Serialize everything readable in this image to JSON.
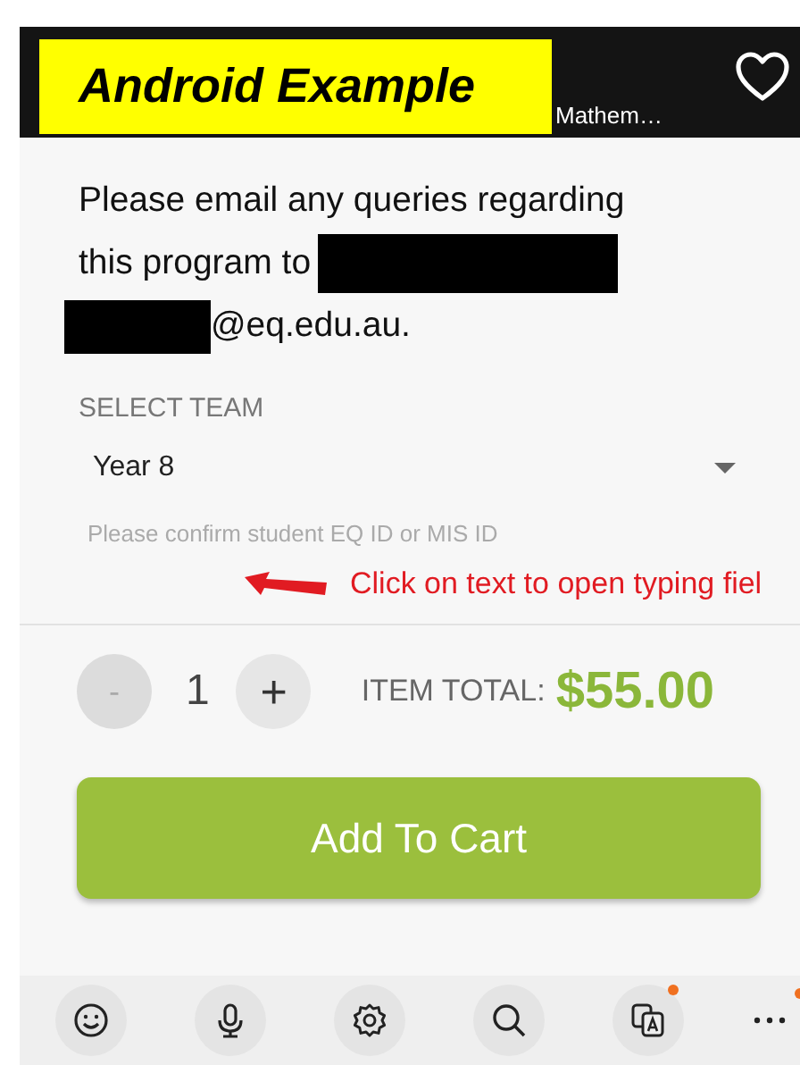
{
  "annotation_label": "Android Example",
  "header": {
    "title": "Mathem…"
  },
  "email_note": {
    "lines": [
      [
        {
          "kind": "text",
          "text": "Please email any queries regarding"
        }
      ],
      [
        {
          "kind": "text",
          "text": "this program to"
        },
        {
          "kind": "redaction"
        }
      ],
      [
        {
          "kind": "redaction"
        },
        {
          "kind": "text",
          "text": "@eq.edu.au."
        }
      ]
    ]
  },
  "team_select": {
    "label": "SELECT TEAM",
    "value": "Year 8"
  },
  "student_id": {
    "placeholder": "Please confirm student EQ ID or MIS ID"
  },
  "annotation_note": "Click on text to open typing fiel",
  "quantity": {
    "minus": "-",
    "value": "1",
    "plus": "+",
    "minus_disabled": true
  },
  "item_total": {
    "label": "ITEM TOTAL:",
    "amount": "$55.00"
  },
  "add_button": "Add To Cart",
  "toolbar": [
    {
      "badge": false
    },
    {
      "badge": false
    },
    {
      "badge": false
    },
    {
      "badge": false
    },
    {
      "badge": true
    },
    {
      "badge": true
    }
  ]
}
